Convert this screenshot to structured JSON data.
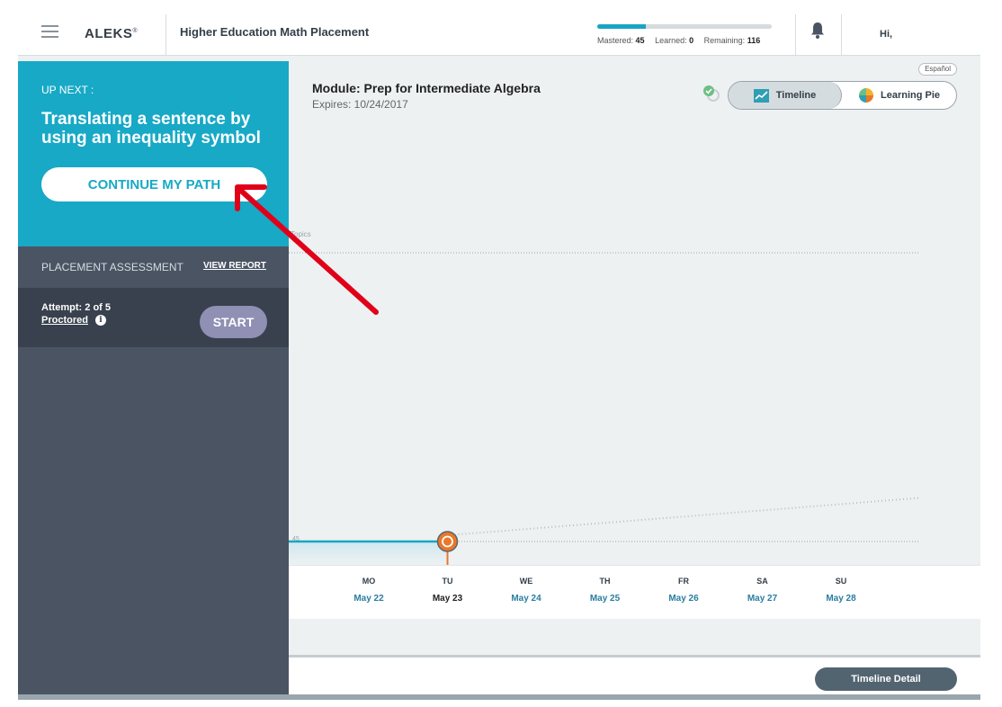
{
  "header": {
    "logo": "ALEKS",
    "logo_mark": "®",
    "course_title": "Higher Education Math Placement",
    "progress": {
      "mastered_label": "Mastered:",
      "mastered": "45",
      "learned_label": "Learned:",
      "learned": "0",
      "remaining_label": "Remaining:",
      "remaining": "116",
      "fill_fraction": 0.28
    },
    "greeting": "Hi,"
  },
  "sidebar": {
    "upnext_label": "UP NEXT :",
    "upnext_topic": "Translating a sentence by using an inequality symbol",
    "continue_label": "CONTINUE MY PATH",
    "placement_label": "PLACEMENT ASSESSMENT",
    "view_report_label": "VIEW REPORT",
    "attempt_text": "Attempt: 2 of 5",
    "proctored_label": "Proctored",
    "info_glyph": "i",
    "start_label": "START"
  },
  "main": {
    "espanol_label": "Español",
    "module_title": "Module: Prep for Intermediate Algebra",
    "expires": "Expires: 10/24/2017",
    "tabs": [
      {
        "label": "Timeline",
        "icon": "line-chart-icon",
        "active": true
      },
      {
        "label": "Learning Pie",
        "icon": "pie-chart-icon",
        "active": false
      }
    ],
    "timeline_detail_label": "Timeline Detail"
  },
  "chart_data": {
    "type": "line",
    "ylabel": "Topics",
    "ylim": [
      45,
      161
    ],
    "y_ticks": [
      "45"
    ],
    "categories": [
      "MO",
      "TU",
      "WE",
      "TH",
      "FR",
      "SA",
      "SU"
    ],
    "dates": [
      "May 22",
      "May 23",
      "May 24",
      "May 25",
      "May 26",
      "May 27",
      "May 28"
    ],
    "current_index": 1,
    "series": [
      {
        "values": [
          45,
          45
        ]
      },
      {
        "values": [
          45,
          47.5,
          50,
          52.5,
          55,
          57.5,
          60
        ]
      }
    ],
    "colors": {
      "progress": "#17a5c2",
      "current_marker": "#e8782a",
      "projection": "#b8bec3"
    }
  },
  "colors": {
    "accent": "#17a9c6",
    "sidebar": "#4a5463",
    "sidebar_dark": "#38414d",
    "start_button": "#8f90b4",
    "annotation_arrow": "#e0001a"
  }
}
